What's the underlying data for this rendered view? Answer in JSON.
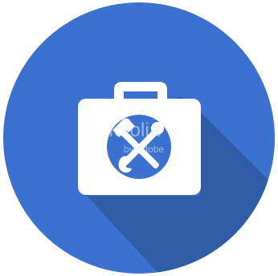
{
  "icon": {
    "name": "toolbox-icon",
    "description_label": "Toolbox with crossed hammer and wrench",
    "colors": {
      "circle": "#3b72d1",
      "long_shadow": "#2f5ea7",
      "case": "#ffffff",
      "emblem_circle": "#3b72d1",
      "tools": "#ffffff",
      "background": "#ffffff"
    }
  },
  "watermark": {
    "brand": "fotolia",
    "sub": "by Adobe"
  }
}
